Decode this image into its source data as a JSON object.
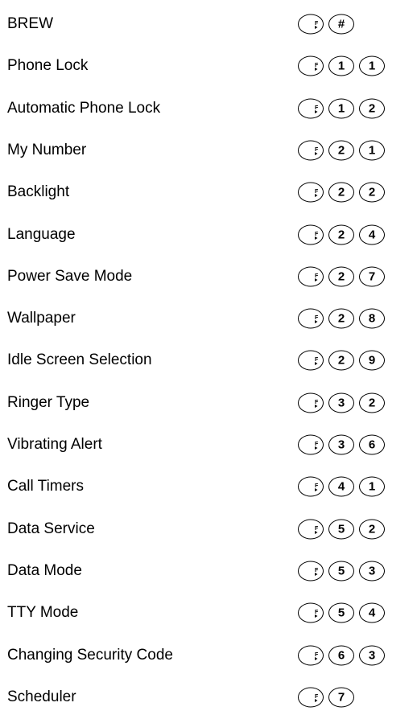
{
  "shortcuts": [
    {
      "label": "BREW",
      "keys": [
        "#"
      ]
    },
    {
      "label": "Phone Lock",
      "keys": [
        "1",
        "1"
      ]
    },
    {
      "label": "Automatic Phone Lock",
      "keys": [
        "1",
        "2"
      ]
    },
    {
      "label": "My Number",
      "keys": [
        "2",
        "1"
      ]
    },
    {
      "label": "Backlight",
      "keys": [
        "2",
        "2"
      ]
    },
    {
      "label": "Language",
      "keys": [
        "2",
        "4"
      ]
    },
    {
      "label": "Power Save Mode",
      "keys": [
        "2",
        "7"
      ]
    },
    {
      "label": "Wallpaper",
      "keys": [
        "2",
        "8"
      ]
    },
    {
      "label": "Idle Screen Selection",
      "keys": [
        "2",
        "9"
      ]
    },
    {
      "label": "Ringer Type",
      "keys": [
        "3",
        "2"
      ]
    },
    {
      "label": "Vibrating Alert",
      "keys": [
        "3",
        "6"
      ]
    },
    {
      "label": "Call Timers",
      "keys": [
        "4",
        "1"
      ]
    },
    {
      "label": "Data Service",
      "keys": [
        "5",
        "2"
      ]
    },
    {
      "label": "Data Mode",
      "keys": [
        "5",
        "3"
      ]
    },
    {
      "label": "TTY Mode",
      "keys": [
        "5",
        "4"
      ]
    },
    {
      "label": "Changing Security Code",
      "keys": [
        "6",
        "3"
      ]
    },
    {
      "label": "Scheduler",
      "keys": [
        "7"
      ]
    }
  ],
  "menu_key": {
    "icon": "menu-key-icon",
    "glyph": "F"
  }
}
